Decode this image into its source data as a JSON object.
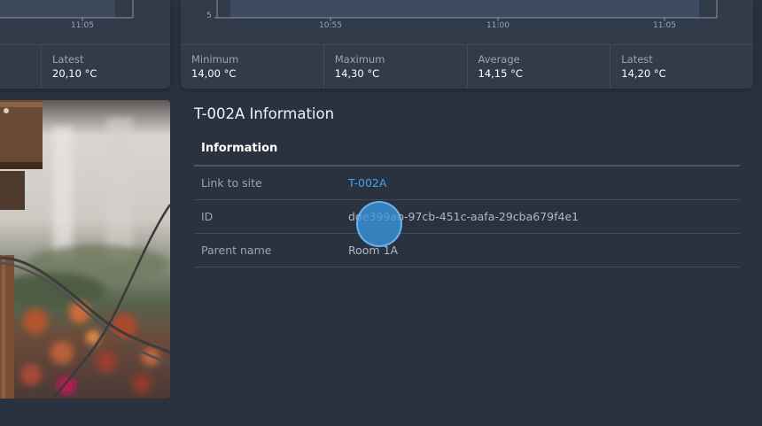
{
  "left_card": {
    "tick": "11:05",
    "stats": [
      {
        "label": "Latest",
        "value": "20,10 °C"
      }
    ]
  },
  "right_card": {
    "y_tick": "5",
    "x_ticks": [
      "10:55",
      "11:00",
      "11:05"
    ],
    "stats": [
      {
        "label": "Minimum",
        "value": "14,00 °C"
      },
      {
        "label": "Maximum",
        "value": "14,30 °C"
      },
      {
        "label": "Average",
        "value": "14,15 °C"
      },
      {
        "label": "Latest",
        "value": "14,20 °C"
      }
    ]
  },
  "info": {
    "title": "T-002A Information",
    "header": "Information",
    "rows": [
      {
        "key": "Link to site",
        "value": "T-002A"
      },
      {
        "key": "ID",
        "value": "dde399ab-97cb-451c-aafa-29cba679f4e1"
      },
      {
        "key": "Parent name",
        "value": "Room 1A"
      }
    ]
  },
  "colors": {
    "background": "#2a3240",
    "card": "#323b49",
    "link": "#3fa7e8",
    "cursor": "#3a96de"
  }
}
